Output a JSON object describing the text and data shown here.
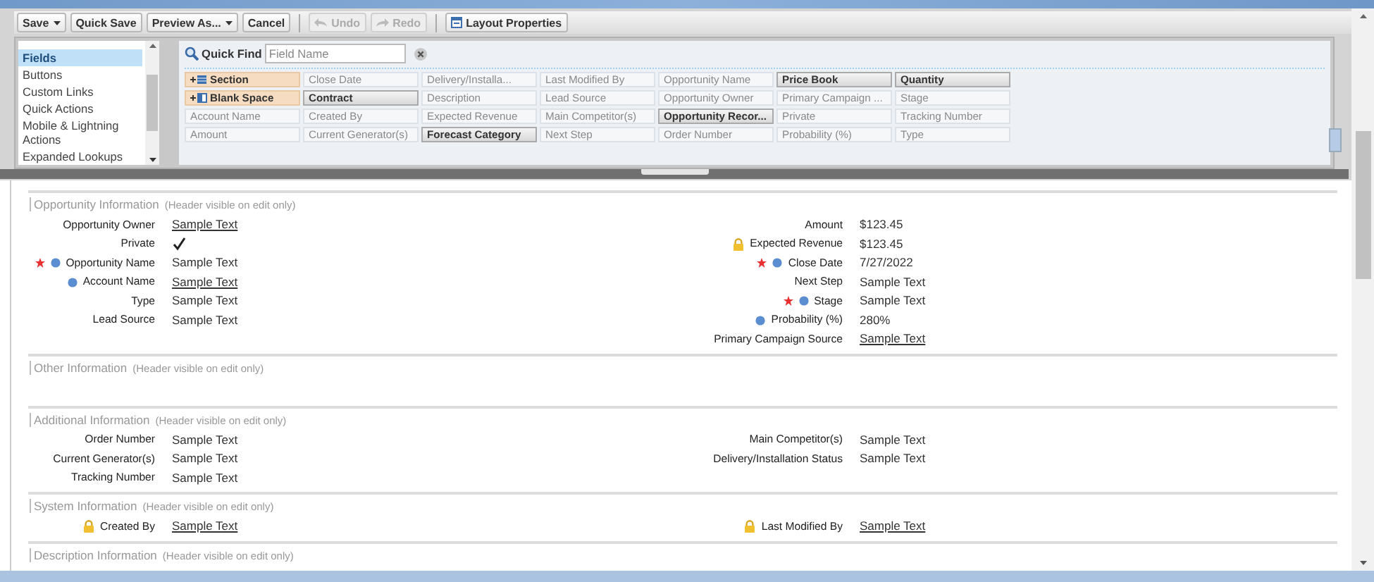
{
  "toolbar": {
    "buttons": [
      {
        "label": "Save",
        "kind": "split",
        "disabled": false
      },
      {
        "label": "Quick Save",
        "kind": "plain",
        "disabled": false
      },
      {
        "label": "Preview As...",
        "kind": "split",
        "disabled": false
      },
      {
        "label": "Cancel",
        "kind": "plain",
        "disabled": false
      },
      {
        "label": "Undo",
        "kind": "undo",
        "disabled": true
      },
      {
        "label": "Redo",
        "kind": "redo",
        "disabled": true
      },
      {
        "label": "Layout Properties",
        "kind": "properties",
        "disabled": false
      }
    ]
  },
  "palette": {
    "categories": [
      {
        "label": "Fields",
        "selected": true
      },
      {
        "label": "Buttons",
        "selected": false
      },
      {
        "label": "Custom Links",
        "selected": false
      },
      {
        "label": "Quick Actions",
        "selected": false
      },
      {
        "label": "Mobile & Lightning Actions",
        "selected": false
      },
      {
        "label": "Expanded Lookups",
        "selected": false
      }
    ],
    "quick_find": {
      "label": "Quick Find",
      "placeholder": "Field Name"
    },
    "fields": [
      {
        "label": "Section",
        "kind": "section",
        "in_layout": false
      },
      {
        "label": "Close Date",
        "kind": "field",
        "in_layout": true
      },
      {
        "label": "Delivery/Installa...",
        "kind": "field",
        "in_layout": true
      },
      {
        "label": "Last Modified By",
        "kind": "field",
        "in_layout": true
      },
      {
        "label": "Opportunity Name",
        "kind": "field",
        "in_layout": true
      },
      {
        "label": "Price Book",
        "kind": "field",
        "in_layout": false
      },
      {
        "label": "Quantity",
        "kind": "field",
        "in_layout": false
      },
      {
        "label": "Blank Space",
        "kind": "blank_space",
        "in_layout": false
      },
      {
        "label": "Contract",
        "kind": "field",
        "in_layout": false
      },
      {
        "label": "Description",
        "kind": "field",
        "in_layout": true
      },
      {
        "label": "Lead Source",
        "kind": "field",
        "in_layout": true
      },
      {
        "label": "Opportunity Owner",
        "kind": "field",
        "in_layout": true
      },
      {
        "label": "Primary Campaign ...",
        "kind": "field",
        "in_layout": true
      },
      {
        "label": "Stage",
        "kind": "field",
        "in_layout": true
      },
      {
        "label": "Account Name",
        "kind": "field",
        "in_layout": true
      },
      {
        "label": "Created By",
        "kind": "field",
        "in_layout": true
      },
      {
        "label": "Expected Revenue",
        "kind": "field",
        "in_layout": true
      },
      {
        "label": "Main Competitor(s)",
        "kind": "field",
        "in_layout": true
      },
      {
        "label": "Opportunity Recor...",
        "kind": "field",
        "in_layout": false
      },
      {
        "label": "Private",
        "kind": "field",
        "in_layout": true
      },
      {
        "label": "Tracking Number",
        "kind": "field",
        "in_layout": true
      },
      {
        "label": "Amount",
        "kind": "field",
        "in_layout": true
      },
      {
        "label": "Current Generator(s)",
        "kind": "field",
        "in_layout": true
      },
      {
        "label": "Forecast Category",
        "kind": "field",
        "in_layout": false
      },
      {
        "label": "Next Step",
        "kind": "field",
        "in_layout": true
      },
      {
        "label": "Order Number",
        "kind": "field",
        "in_layout": true
      },
      {
        "label": "Probability (%)",
        "kind": "field",
        "in_layout": true
      },
      {
        "label": "Type",
        "kind": "field",
        "in_layout": true
      }
    ]
  },
  "sections": [
    {
      "title": "Opportunity Information",
      "note": "(Header visible on edit only)",
      "left": [
        {
          "label": "Opportunity Owner",
          "kind": "text",
          "value": "Sample Text",
          "link": true,
          "required": false,
          "dot": false,
          "locked": false
        },
        {
          "label": "Private",
          "kind": "checkbox",
          "checked": true,
          "required": false,
          "dot": false,
          "locked": false
        },
        {
          "label": "Opportunity Name",
          "kind": "text",
          "value": "Sample Text",
          "link": false,
          "required": true,
          "dot": true,
          "locked": false
        },
        {
          "label": "Account Name",
          "kind": "text",
          "value": "Sample Text",
          "link": true,
          "required": false,
          "dot": true,
          "locked": false
        },
        {
          "label": "Type",
          "kind": "text",
          "value": "Sample Text",
          "link": false,
          "required": false,
          "dot": false,
          "locked": false
        },
        {
          "label": "Lead Source",
          "kind": "text",
          "value": "Sample Text",
          "link": false,
          "required": false,
          "dot": false,
          "locked": false
        }
      ],
      "right": [
        {
          "label": "Amount",
          "kind": "text",
          "value": "$123.45",
          "link": false,
          "required": false,
          "dot": false,
          "locked": false
        },
        {
          "label": "Expected Revenue",
          "kind": "text",
          "value": "$123.45",
          "link": false,
          "required": false,
          "dot": false,
          "locked": true
        },
        {
          "label": "Close Date",
          "kind": "text",
          "value": "7/27/2022",
          "link": false,
          "required": true,
          "dot": true,
          "locked": false
        },
        {
          "label": "Next Step",
          "kind": "text",
          "value": "Sample Text",
          "link": false,
          "required": false,
          "dot": false,
          "locked": false
        },
        {
          "label": "Stage",
          "kind": "text",
          "value": "Sample Text",
          "link": false,
          "required": true,
          "dot": true,
          "locked": false
        },
        {
          "label": "Probability (%)",
          "kind": "text",
          "value": "280%",
          "link": false,
          "required": false,
          "dot": true,
          "locked": false
        },
        {
          "label": "Primary Campaign Source",
          "kind": "text",
          "value": "Sample Text",
          "link": true,
          "required": false,
          "dot": false,
          "locked": false
        }
      ]
    },
    {
      "title": "Other Information",
      "note": "(Header visible on edit only)"
    },
    {
      "title": "Additional Information",
      "note": "(Header visible on edit only)",
      "left": [
        {
          "label": "Order Number",
          "kind": "text",
          "value": "Sample Text",
          "link": false,
          "required": false,
          "dot": false,
          "locked": false
        },
        {
          "label": "Current Generator(s)",
          "kind": "text",
          "value": "Sample Text",
          "link": false,
          "required": false,
          "dot": false,
          "locked": false
        },
        {
          "label": "Tracking Number",
          "kind": "text",
          "value": "Sample Text",
          "link": false,
          "required": false,
          "dot": false,
          "locked": false
        }
      ],
      "right": [
        {
          "label": "Main Competitor(s)",
          "kind": "text",
          "value": "Sample Text",
          "link": false,
          "required": false,
          "dot": false,
          "locked": false
        },
        {
          "label": "Delivery/Installation Status",
          "kind": "text",
          "value": "Sample Text",
          "link": false,
          "required": false,
          "dot": false,
          "locked": false
        }
      ]
    },
    {
      "title": "System Information",
      "note": "(Header visible on edit only)",
      "left": [
        {
          "label": "Created By",
          "kind": "text",
          "value": "Sample Text",
          "link": true,
          "required": false,
          "dot": false,
          "locked": true
        }
      ],
      "right": [
        {
          "label": "Last Modified By",
          "kind": "text",
          "value": "Sample Text",
          "link": true,
          "required": false,
          "dot": false,
          "locked": true
        }
      ]
    },
    {
      "title": "Description Information",
      "note": "(Header visible on edit only)"
    }
  ]
}
